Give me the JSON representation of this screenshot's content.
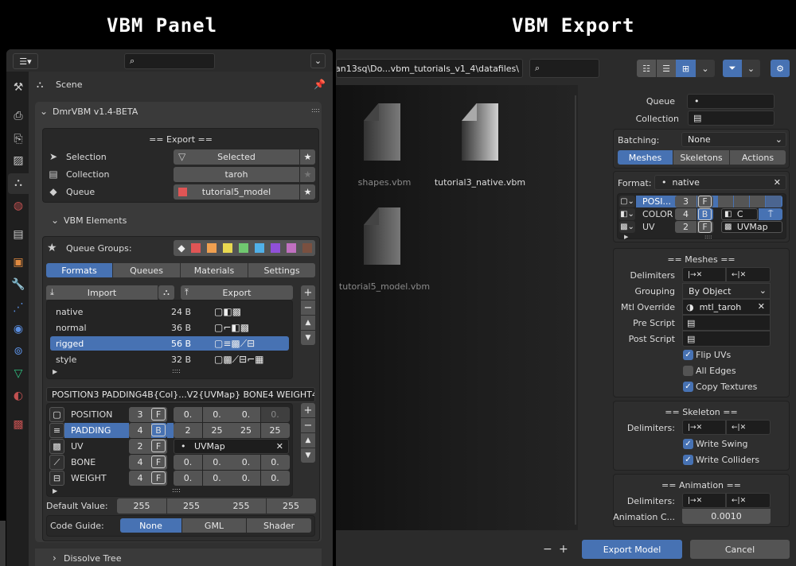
{
  "titles": {
    "left": "VBM Panel",
    "right": "VBM Export"
  },
  "panel": {
    "scene": "Scene",
    "addon_title": "DmrVBM v1.4-BETA",
    "export": {
      "heading": "== Export ==",
      "rows": [
        {
          "label": "Selection",
          "value": "Selected",
          "icon": "cursor-icon"
        },
        {
          "label": "Collection",
          "value": "taroh",
          "icon": "collection-icon"
        },
        {
          "label": "Queue",
          "value": "tutorial5_model",
          "icon": "diamond-icon",
          "color": "#e05555"
        }
      ]
    },
    "elements_title": "VBM Elements",
    "queue_groups": {
      "label": "Queue Groups:",
      "colors": [
        "#e05555",
        "#f0a050",
        "#e8d850",
        "#70c870",
        "#50b0e8",
        "#9050d8",
        "#c070c0",
        "#7a5040"
      ]
    },
    "tabs": [
      "Formats",
      "Queues",
      "Materials",
      "Settings"
    ],
    "active_tab": 0,
    "import_label": "Import",
    "export_label": "Export",
    "formats": [
      {
        "name": "native",
        "size": "24 B"
      },
      {
        "name": "normal",
        "size": "36 B"
      },
      {
        "name": "rigged",
        "size": "56 B"
      },
      {
        "name": "style",
        "size": "32 B"
      }
    ],
    "selected_format": 2,
    "format_string": "POSITION3 PADDING4B{Col}...V2{UVMap} BONE4 WEIGHT4",
    "attributes": [
      {
        "name": "POSITION",
        "size": "3",
        "type": "F",
        "values": [
          "0.",
          "0.",
          "0.",
          "0."
        ]
      },
      {
        "name": "PADDING",
        "size": "4",
        "type": "B",
        "values": [
          "2",
          "25",
          "25",
          "25"
        ]
      },
      {
        "name": "UV",
        "size": "2",
        "type": "F",
        "layer": "UVMap"
      },
      {
        "name": "BONE",
        "size": "4",
        "type": "F",
        "values": [
          "0.",
          "0.",
          "0.",
          "0."
        ]
      },
      {
        "name": "WEIGHT",
        "size": "4",
        "type": "F",
        "values": [
          "0.",
          "0.",
          "0.",
          "0."
        ]
      }
    ],
    "selected_attribute": 1,
    "default_value": {
      "label": "Default Value:",
      "values": [
        "255",
        "255",
        "255",
        "255"
      ]
    },
    "code_guide": {
      "label": "Code Guide:",
      "options": [
        "None",
        "GML",
        "Shader"
      ],
      "selected": 0
    },
    "dissolve_tree": "Dissolve Tree"
  },
  "export_dialog": {
    "path": "an13sq\\Do...vbm_tutorials_v1_4\\datafiles\\",
    "files": [
      "shapes.vbm",
      "tutorial3_native.vbm",
      "tutorial5_model.vbm"
    ],
    "queue_label": "Queue",
    "queue_value": "•",
    "collection_label": "Collection",
    "batching": {
      "label": "Batching:",
      "value": "None"
    },
    "modes": [
      "Meshes",
      "Skeletons",
      "Actions"
    ],
    "active_mode": 0,
    "format": {
      "label": "Format:",
      "value": "native"
    },
    "attrs": [
      {
        "name": "POSI...",
        "size": "3",
        "type": "F"
      },
      {
        "name": "COLOR",
        "size": "4",
        "type": "B",
        "layer": "C"
      },
      {
        "name": "UV",
        "size": "2",
        "type": "F",
        "layer": "UVMap"
      }
    ],
    "meshes": {
      "heading": "== Meshes ==",
      "delimiters_label": "Delimiters",
      "grouping_label": "Grouping",
      "grouping_value": "By Object",
      "mtl_label": "Mtl Override",
      "mtl_value": "mtl_taroh",
      "pre_script_label": "Pre Script",
      "post_script_label": "Post Script",
      "checks": [
        {
          "label": "Flip UVs",
          "checked": true
        },
        {
          "label": "All Edges",
          "checked": false
        },
        {
          "label": "Copy Textures",
          "checked": true
        }
      ]
    },
    "skeleton": {
      "heading": "== Skeleton ==",
      "delimiters_label": "Delimiters:",
      "checks": [
        {
          "label": "Write Swing",
          "checked": true
        },
        {
          "label": "Write Colliders",
          "checked": true
        }
      ]
    },
    "animation": {
      "heading": "== Animation ==",
      "delimiters_label": "Delimiters:",
      "compression_label": "Animation C...",
      "compression_value": "0.0010"
    },
    "buttons": {
      "export": "Export Model",
      "cancel": "Cancel"
    }
  },
  "colors": {
    "accent": "#4772b3",
    "panel_bg": "#303030",
    "box_bg": "#282828",
    "button": "#545454"
  }
}
